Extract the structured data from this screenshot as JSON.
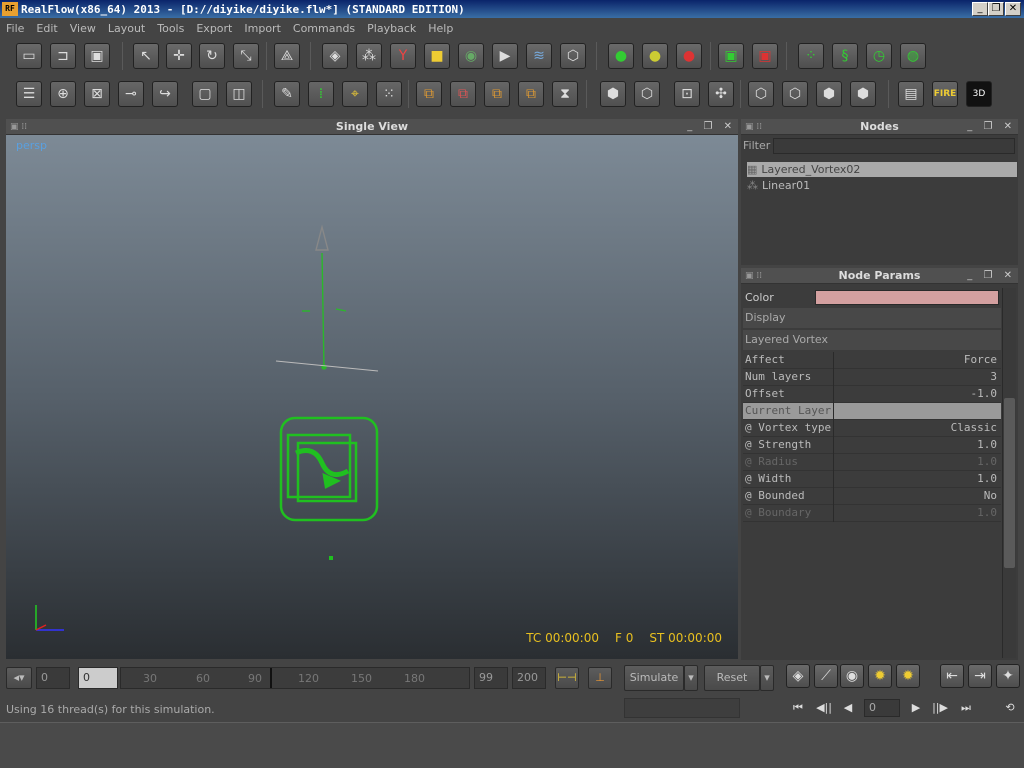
{
  "window": {
    "title": "RealFlow(x86_64) 2013 - [D://diyike/diyike.flw*] (STANDARD EDITION)",
    "logo": "RF",
    "minimize": "_",
    "maximize": "❐",
    "close": "✕"
  },
  "menu": [
    "File",
    "Edit",
    "View",
    "Layout",
    "Tools",
    "Export",
    "Import",
    "Commands",
    "Playback",
    "Help"
  ],
  "viewport": {
    "title": "Single View",
    "camera": "persp",
    "tc": "TC 00:00:00",
    "frame": "F 0",
    "st": "ST 00:00:00"
  },
  "nodes": {
    "title": "Nodes",
    "filter_label": "Filter",
    "items": [
      {
        "label": "Layered_Vortex02",
        "selected": true
      },
      {
        "label": "Linear01",
        "selected": false
      }
    ]
  },
  "params": {
    "title": "Node Params",
    "color_label": "Color",
    "color_value": "#d4a0a0",
    "display_label": "Display",
    "section": "Layered Vortex",
    "rows": [
      {
        "k": "Affect",
        "v": "Force",
        "dim": false
      },
      {
        "k": "Num layers",
        "v": "3",
        "dim": false
      },
      {
        "k": "Offset",
        "v": "-1.0",
        "dim": false
      },
      {
        "k": "Current Layer",
        "v": "",
        "dim": false,
        "sel": true
      },
      {
        "k": "@ Vortex type",
        "v": "Classic",
        "dim": false
      },
      {
        "k": "@ Strength",
        "v": "1.0",
        "dim": false
      },
      {
        "k": "@ Radius",
        "v": "1.0",
        "dim": true
      },
      {
        "k": "@ Width",
        "v": "1.0",
        "dim": false
      },
      {
        "k": "@ Bounded",
        "v": "No",
        "dim": false
      },
      {
        "k": "@ Boundary",
        "v": "1.0",
        "dim": true
      }
    ]
  },
  "timeline": {
    "start": "0",
    "current": "0",
    "ticks": [
      "30",
      "60",
      "90",
      "120",
      "150",
      "180"
    ],
    "end_a": "99",
    "end_b": "200",
    "simulate": "Simulate",
    "reset": "Reset"
  },
  "status": "Using 16 thread(s) for this simulation.",
  "playback_frame": "0",
  "playback_buttons": [
    "⏮",
    "◀||",
    "◀",
    "▶",
    "||▶",
    "⏭"
  ]
}
